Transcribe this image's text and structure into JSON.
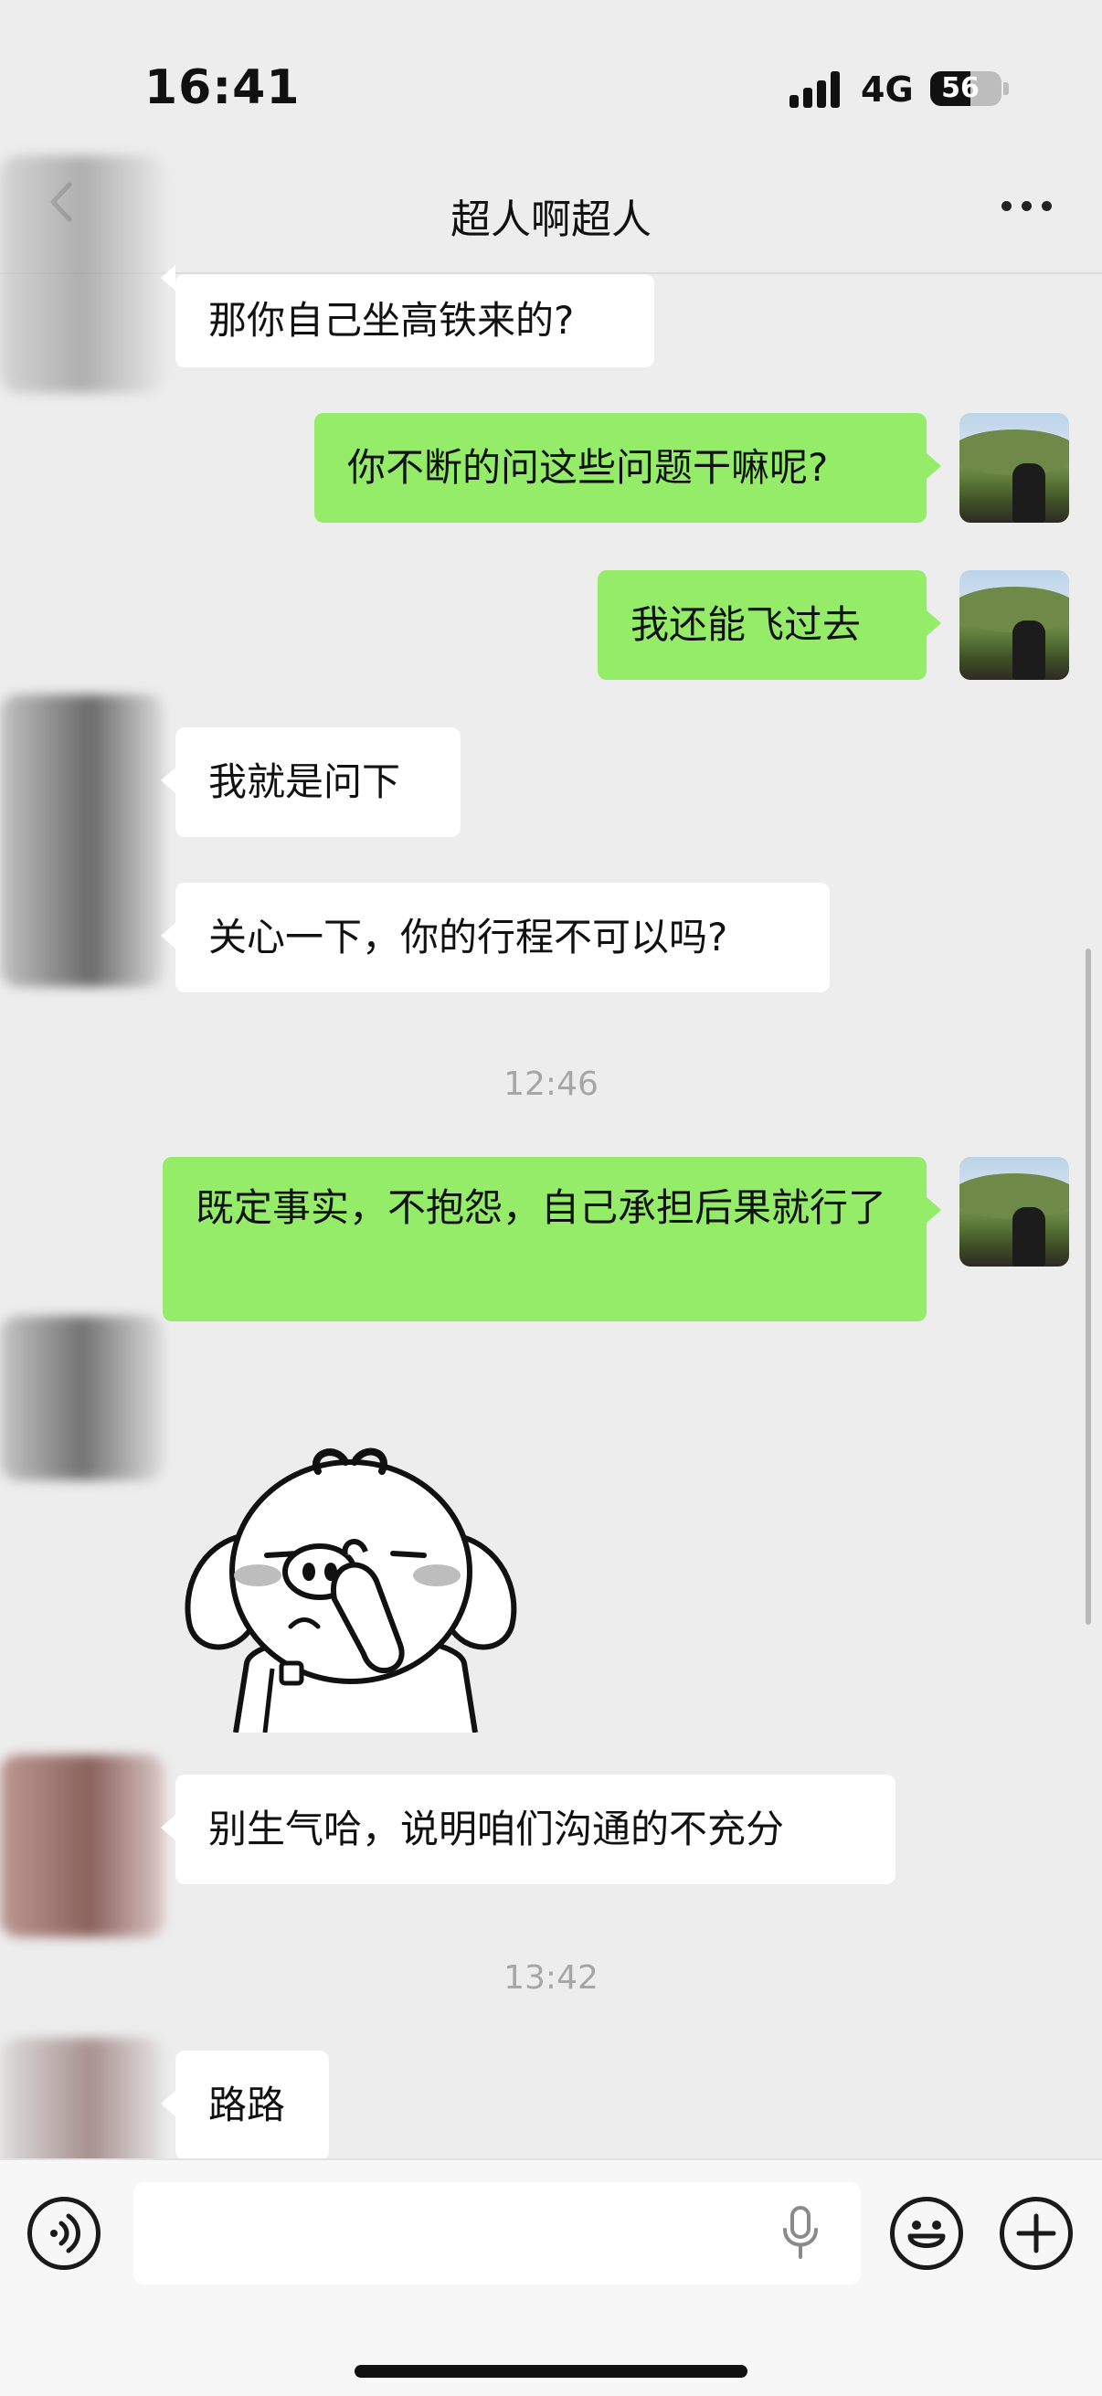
{
  "status_bar": {
    "time": "16:41",
    "network": "4G",
    "battery": "56",
    "battery_level_percent": 56
  },
  "header": {
    "title": "超人啊超人"
  },
  "messages": [
    {
      "side": "left",
      "text": "那你自己坐高铁来的?"
    },
    {
      "side": "right",
      "text": "你不断的问这些问题干嘛呢?"
    },
    {
      "side": "right",
      "text": "我还能飞过去"
    },
    {
      "side": "left",
      "text": "我就是问下"
    },
    {
      "side": "left",
      "text": "关心一下，你的行程不可以吗?"
    },
    {
      "timestamp": "12:46"
    },
    {
      "side": "right",
      "text": "既定事实，不抱怨，自己承担后果就行了"
    },
    {
      "side": "left",
      "type": "sticker",
      "sticker": "pig-thinking-sticker"
    },
    {
      "side": "left",
      "text": "别生气哈，说明咱们沟通的不充分"
    },
    {
      "timestamp": "13:42"
    },
    {
      "side": "left",
      "text": "路路"
    }
  ],
  "input_bar": {
    "voice_icon": "voice-toggle-icon",
    "mic_icon": "microphone-icon",
    "emoji_icon": "emoji-icon",
    "plus_icon": "plus-icon",
    "input_value": ""
  },
  "colors": {
    "background": "#ededed",
    "bubble_mine": "#95ec69",
    "bubble_theirs": "#ffffff",
    "timestamp": "#a6a6a6"
  }
}
